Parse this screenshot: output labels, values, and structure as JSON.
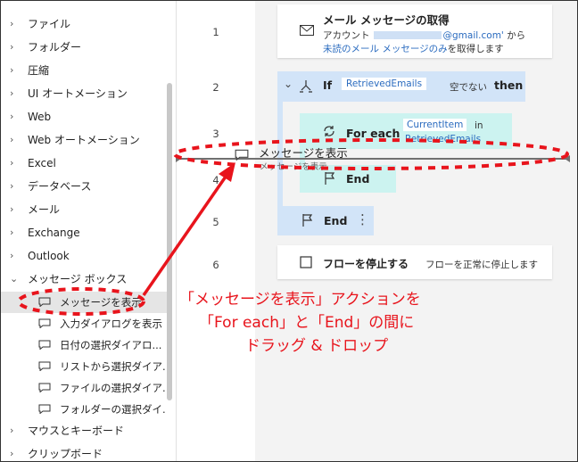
{
  "sidebar": {
    "items": [
      {
        "label": "ファイル"
      },
      {
        "label": "フォルダー"
      },
      {
        "label": "圧縮"
      },
      {
        "label": "UI オートメーション"
      },
      {
        "label": "Web"
      },
      {
        "label": "Web オートメーション"
      },
      {
        "label": "Excel"
      },
      {
        "label": "データベース"
      },
      {
        "label": "メール"
      },
      {
        "label": "Exchange"
      },
      {
        "label": "Outlook"
      },
      {
        "label": "メッセージ ボックス"
      }
    ],
    "message_box_actions": [
      {
        "label": "メッセージを表示"
      },
      {
        "label": "入力ダイアログを表示"
      },
      {
        "label": "日付の選択ダイアロ..."
      },
      {
        "label": "リストから選択ダイア..."
      },
      {
        "label": "ファイルの選択ダイア..."
      },
      {
        "label": "フォルダーの選択ダイ..."
      }
    ],
    "items_after": [
      {
        "label": "マウスとキーボード"
      },
      {
        "label": "クリップボード"
      }
    ],
    "chevron_collapsed": "›",
    "chevron_expanded": "⌄"
  },
  "flow": {
    "line_numbers": [
      "1",
      "2",
      "3",
      "4",
      "5",
      "6"
    ],
    "step1": {
      "title": "メール メッセージの取得",
      "account_label": "アカウント",
      "email": "@gmail.com'",
      "from": "から",
      "unread": "未読のメール メッセージのみ",
      "retrieve": "を取得します"
    },
    "step2": {
      "keyword_if": "If",
      "variable": "RetrievedEmails",
      "condition": "空でない",
      "keyword_then": "then"
    },
    "step3": {
      "keyword": "For each",
      "item": "CurrentItem",
      "in": "in",
      "collection": "RetrievedEmails"
    },
    "step4": {
      "keyword": "End"
    },
    "step5": {
      "keyword": "End",
      "more": "⋮"
    },
    "step6": {
      "title": "フローを停止する",
      "desc": "フローを正常に停止します"
    }
  },
  "drag_preview": {
    "title": "メッセージを表示",
    "subtitle": "メッセージを表示"
  },
  "callout": {
    "line1": "「メッセージを表示」アクションを",
    "line2": "「For each」と「End」の間に",
    "line3": "ドラッグ & ドロップ"
  },
  "colors": {
    "annotation": "#e8141c",
    "if_block": "#d2e4f8",
    "loop_block": "#ccf3f0",
    "token": "#2a6bbf"
  }
}
